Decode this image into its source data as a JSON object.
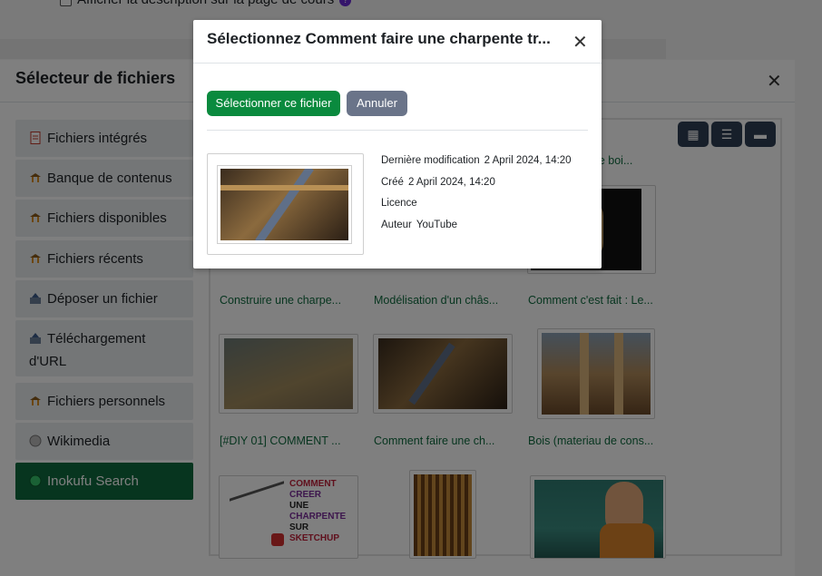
{
  "page": {
    "course_option_label": "Afficher la description sur la page de cours"
  },
  "file_picker": {
    "title": "Sélecteur de fichiers",
    "repositories": [
      {
        "label": "Fichiers intégrés",
        "icon": "document-icon"
      },
      {
        "label": "Banque de contenus",
        "icon": "repository-icon"
      },
      {
        "label": "Fichiers disponibles",
        "icon": "repository-icon"
      },
      {
        "label": "Fichiers récents",
        "icon": "repository-icon"
      },
      {
        "label": "Déposer un fichier",
        "icon": "upload-icon"
      },
      {
        "label": "Téléchargement d'URL",
        "icon": "upload-icon"
      },
      {
        "label": "Fichiers personnels",
        "icon": "repository-icon"
      },
      {
        "label": "Wikimedia",
        "icon": "globe-icon"
      },
      {
        "label": "Inokufu Search",
        "icon": "globe-icon",
        "active": true
      }
    ],
    "view_buttons": [
      "grid-view-icon",
      "list-view-icon",
      "folder-view-icon"
    ],
    "files_row0": [
      {
        "name": "...sir le boi..."
      }
    ],
    "files_row1": [
      {
        "name": "Construire une charpe..."
      },
      {
        "name": "Modélisation d'un châs..."
      },
      {
        "name": "Comment c'est fait : Le..."
      }
    ],
    "files_row2": [
      {
        "name": "[#DIY 01] COMMENT ..."
      },
      {
        "name": "Comment faire une ch..."
      },
      {
        "name": "Bois (materiau de cons..."
      }
    ],
    "sketchup_thumb_text": [
      "COMMENT",
      "CREER",
      "UNE",
      "CHARPENTE",
      "SUR",
      "SKETCHUP"
    ]
  },
  "modal": {
    "title": "Sélectionnez Comment faire une charpente tr...",
    "select_label": "Sélectionner ce fichier",
    "cancel_label": "Annuler",
    "meta": {
      "modified_label": "Dernière modification",
      "modified_value": "2 April 2024, 14:20",
      "created_label": "Créé",
      "created_value": "2 April 2024, 14:20",
      "license_label": "Licence",
      "author_label": "Auteur",
      "author_value": "YouTube"
    }
  },
  "colors": {
    "active_repo": "#0f6b3f",
    "select_button": "#0a8a3e",
    "cancel_button": "#6a7489",
    "view_button": "#2f3e55",
    "file_name": "#0f6b3f"
  }
}
